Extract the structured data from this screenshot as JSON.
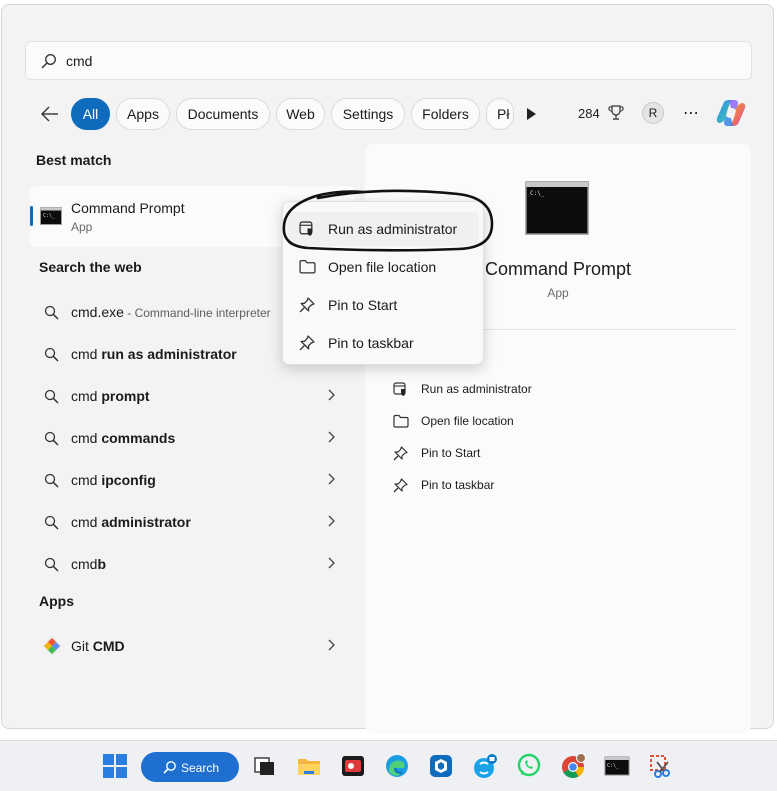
{
  "search": {
    "query": "cmd"
  },
  "filters": {
    "chips": [
      "All",
      "Apps",
      "Documents",
      "Web",
      "Settings",
      "Folders",
      "Pł"
    ],
    "points": "284",
    "avatar": "R"
  },
  "best_match": {
    "heading": "Best match",
    "title": "Command Prompt",
    "subtitle": "App"
  },
  "web": {
    "heading": "Search the web",
    "results": [
      {
        "plain": "cmd.exe",
        "bold": "",
        "desc": " - Command-line interpreter",
        "chevron": false
      },
      {
        "plain": "cmd ",
        "bold": "run as administrator",
        "desc": "",
        "chevron": false
      },
      {
        "plain": "cmd ",
        "bold": "prompt",
        "desc": "",
        "chevron": true
      },
      {
        "plain": "cmd ",
        "bold": "commands",
        "desc": "",
        "chevron": true
      },
      {
        "plain": "cmd ",
        "bold": "ipconfig",
        "desc": "",
        "chevron": true
      },
      {
        "plain": "cmd ",
        "bold": "administrator",
        "desc": "",
        "chevron": true
      },
      {
        "plain": "cmd",
        "bold": "b",
        "desc": "",
        "chevron": true
      }
    ]
  },
  "apps": {
    "heading": "Apps",
    "items": [
      {
        "plain": "Git ",
        "bold": "CMD"
      }
    ]
  },
  "preview": {
    "title": "Command Prompt",
    "subtitle": "App",
    "actions": [
      "Run as administrator",
      "Open file location",
      "Pin to Start",
      "Pin to taskbar"
    ]
  },
  "context_menu": {
    "items": [
      "Run as administrator",
      "Open file location",
      "Pin to Start",
      "Pin to taskbar"
    ]
  },
  "taskbar": {
    "search_label": "Search"
  },
  "colors": {
    "accent": "#0f6cbd",
    "panel_bg": "#f3f3f3",
    "taskbar_search": "#1f6fd1"
  }
}
